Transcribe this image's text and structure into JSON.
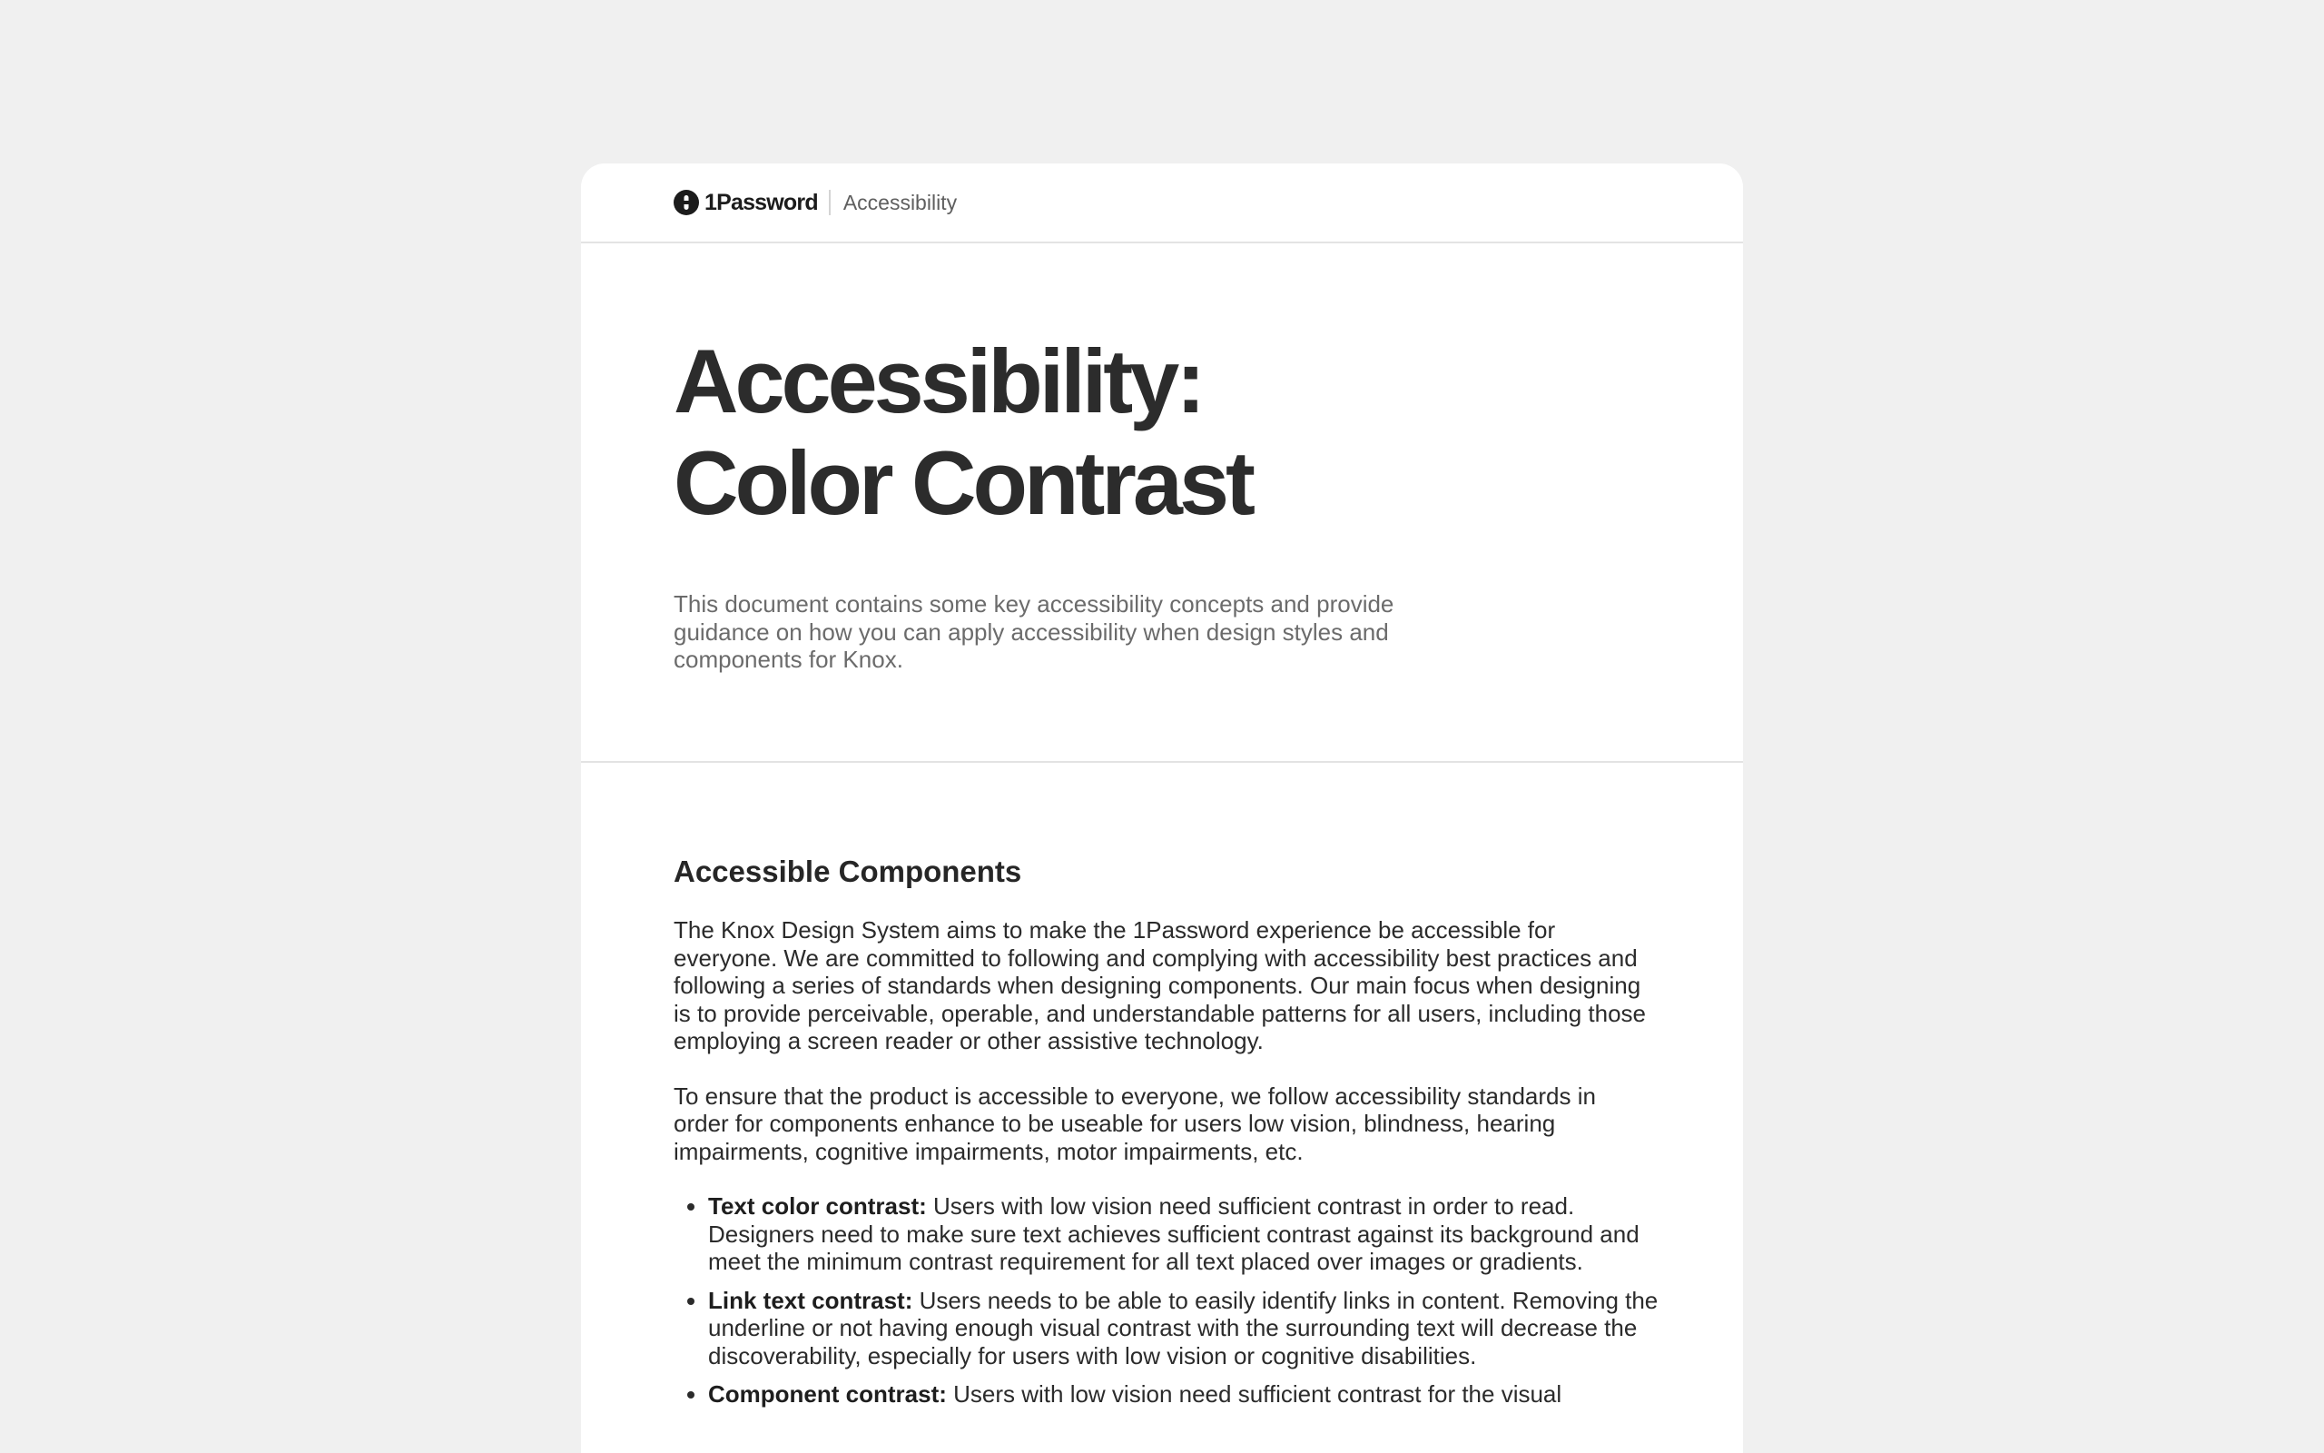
{
  "brand": {
    "logo_text": "1Password",
    "section": "Accessibility"
  },
  "hero": {
    "title_line1": "Accessibility:",
    "title_line2": "Color Contrast",
    "lead": "This document contains some key accessibility concepts and provide guidance on how you can apply accessibility when design styles and components for Knox."
  },
  "content": {
    "heading": "Accessible Components",
    "paragraphs": [
      "The Knox Design System aims to make the 1Password experience be accessible for everyone. We are committed to following and complying with accessibility best practices and following a series of standards when designing components. Our main focus when designing is to provide perceivable, operable, and understandable patterns for all users, including those employing a screen reader or other assistive technology.",
      "To ensure that the product is accessible to everyone, we follow accessibility standards in order for components enhance to be useable for users low vision, blindness, hearing impairments, cognitive impairments, motor impairments, etc."
    ],
    "bullets": [
      {
        "term": "Text color contrast:",
        "text": " Users with low vision need sufficient contrast in order to read. Designers need to make sure text achieves sufficient contrast against its background and meet the minimum contrast requirement for all text placed over images or gradients."
      },
      {
        "term": "Link text contrast:",
        "text": " Users needs to be able to easily identify links in content. Removing the underline or not having enough visual contrast with the surrounding text will decrease the discoverability, especially for users with low vision or cognitive disabilities."
      },
      {
        "term": "Component contrast:",
        "text": " Users with low vision need sufficient contrast for the visual"
      }
    ]
  }
}
